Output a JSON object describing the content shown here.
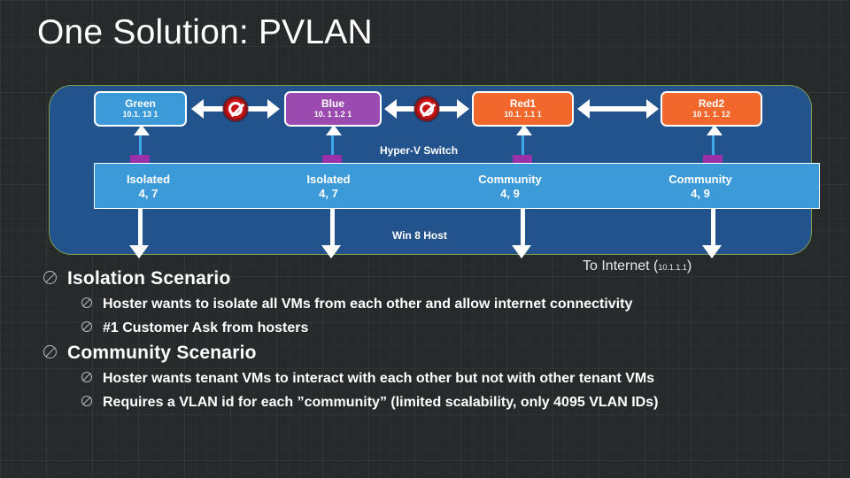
{
  "slide": {
    "title": "One Solution: PVLAN"
  },
  "diagram": {
    "switch_label": "Hyper-V Switch",
    "host_label": "Win 8 Host",
    "internet_label": "To Internet (",
    "internet_ip": "10.1.1.1",
    "internet_label_end": ")",
    "vms": [
      {
        "name": "Green",
        "ip": "10.1. 13 1",
        "color": "#3d9ad9"
      },
      {
        "name": "Blue",
        "ip": "10. 1 1.2 1",
        "color": "#9b4bb0"
      },
      {
        "name": "Red1",
        "ip": "10.1. 1.1 1",
        "color": "#f2682c"
      },
      {
        "name": "Red2",
        "ip": "10 1. 1. 12",
        "color": "#f2682c"
      }
    ],
    "segments": [
      {
        "type": "Isolated",
        "ids": "4, 7"
      },
      {
        "type": "Isolated",
        "ids": "4, 7"
      },
      {
        "type": "Community",
        "ids": "4, 9"
      },
      {
        "type": "Community",
        "ids": "4, 9"
      }
    ],
    "blocked_markers": [
      {
        "name": "no-entry-green-blue"
      },
      {
        "name": "no-entry-blue-red1"
      }
    ]
  },
  "bullets": [
    {
      "level": 1,
      "text": "Isolation Scenario"
    },
    {
      "level": 2,
      "text": "Hoster wants to isolate all VMs from each other and allow internet connectivity"
    },
    {
      "level": 2,
      "text": "#1 Customer Ask from hosters"
    },
    {
      "level": 1,
      "text": "Community Scenario"
    },
    {
      "level": 2,
      "text": "Hoster wants tenant VMs to interact with each other but not with other tenant VMs"
    },
    {
      "level": 2,
      "text": "Requires a VLAN id for each ”community” (limited scalability, only 4095 VLAN IDs)"
    }
  ],
  "colors": {
    "background": "#262a2a",
    "host_container": "#22538c",
    "host_border": "#7d9a4e",
    "switch_bar": "#3d9ad9",
    "port": "#9b30a8",
    "link_line": "#3fa9e8",
    "blocked": "#cc1417"
  }
}
